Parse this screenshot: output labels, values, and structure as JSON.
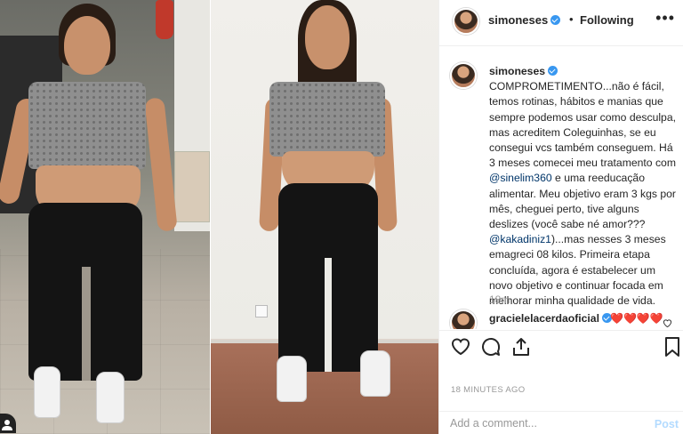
{
  "post": {
    "username": "simoneses",
    "verified": true,
    "follow_status": "Following",
    "dot": "•",
    "more_label": "•••"
  },
  "caption": {
    "username": "simoneses",
    "part1": "COMPROMETIMENTO...não é fácil, temos rotinas, hábitos e manias que sempre podemos usar como desculpa, mas acreditem Coleguinhas, se eu consegui vcs também conseguem. Há 3 meses comecei meu tratamento com ",
    "mention1": "@sinelim360",
    "part2": " e uma reeducação alimentar. Meu objetivo eram 3 kgs por mês, cheguei perto, tive alguns deslizes (você sabe né amor??? ",
    "mention2": "@kakadiniz1",
    "part3": ")...mas nesses 3 meses emagreci 08 kilos. Primeira etapa concluída, agora é estabelecer um novo objetivo e continuar focada em melhorar minha qualidade de vida.",
    "time": "18m"
  },
  "comment": {
    "username": "gracielelacerdaoficial",
    "text": "❤️❤️❤️❤️"
  },
  "timestamp": "18 MINUTES AGO",
  "add_comment": {
    "placeholder": "Add a comment...",
    "post_label": "Post"
  },
  "icons": {
    "like": "heart-outline-icon",
    "comment": "comment-bubble-icon",
    "share": "share-arrow-icon",
    "save": "bookmark-icon",
    "more": "more-dots-icon",
    "verified": "verified-badge-icon"
  },
  "colors": {
    "verified_blue": "#3897f0",
    "post_button_disabled": "#b3dbff",
    "secondary_text": "#999999"
  }
}
